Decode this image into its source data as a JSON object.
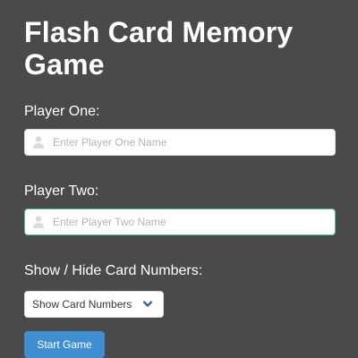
{
  "page": {
    "title": "Flash Card Memory Game"
  },
  "player_one": {
    "label": "Player One:",
    "placeholder": "Enter Player One Name",
    "value": "",
    "icon": "user-icon"
  },
  "player_two": {
    "label": "Player Two:",
    "placeholder": "Enter Player Two Name",
    "value": "",
    "icon": "user-icon",
    "focused": true
  },
  "card_numbers": {
    "label": "Show / Hide Card Numbers:",
    "selected": "Show Card Numbers",
    "icon": "chevron-down-icon"
  },
  "actions": {
    "start_label": "Start Game"
  },
  "colors": {
    "background": "#4a4a4a",
    "accent": "#3e8ed0",
    "focus_border": "#4ec48f",
    "chevron": "#3e5fa8"
  }
}
